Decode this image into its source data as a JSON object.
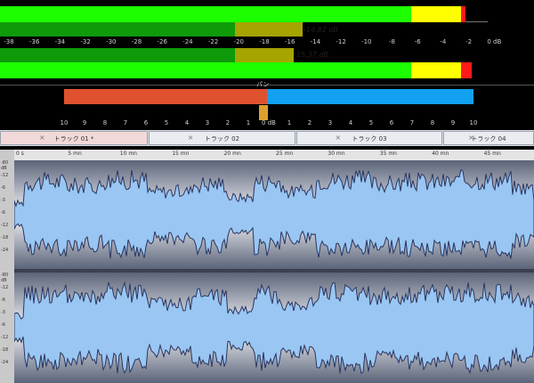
{
  "meters": {
    "scale": [
      "-38",
      "-36",
      "-34",
      "-32",
      "-30",
      "-28",
      "-26",
      "-24",
      "-22",
      "-20",
      "-18",
      "-16",
      "-14",
      "-12",
      "-10",
      "-8",
      "-6",
      "-4",
      "-2",
      "0 dB"
    ],
    "peak_top": "-14.82 dB",
    "peak_bottom": "15.37 dB"
  },
  "pan": {
    "label": "パン",
    "scale": [
      "10",
      "9",
      "8",
      "7",
      "6",
      "5",
      "4",
      "3",
      "2",
      "1",
      "0 dB",
      "1",
      "2",
      "3",
      "4",
      "5",
      "6",
      "7",
      "8",
      "9",
      "10"
    ]
  },
  "tabs": [
    {
      "label": "トラック 01 *",
      "active": true
    },
    {
      "label": "トラック 02",
      "active": false
    },
    {
      "label": "トラック 03",
      "active": false
    },
    {
      "label": "トラック 04",
      "active": false
    }
  ],
  "ruler": [
    "0 s",
    "5 mn",
    "10 mn",
    "15 mn",
    "20 mn",
    "25 mn",
    "30 mn",
    "35 mn",
    "40 mn",
    "45 mn"
  ],
  "vscale_top": [
    "-80 dB",
    "-12",
    "-6",
    "-3",
    "-6",
    "-12",
    "-18",
    "-24"
  ],
  "vscale_bottom": [
    "-80 dB",
    "-12",
    "-6",
    "-3",
    "-6",
    "-12",
    "-18",
    "-24"
  ],
  "colors": {
    "meter_green": "#1dff00",
    "meter_dark_green": "#0f9a0a",
    "meter_olive": "#a6a400",
    "meter_yellow": "#ffff00",
    "meter_red": "#ff1a1a",
    "pan_left": "#e0522f",
    "pan_right": "#12a0f0",
    "wave": "#99c6f2",
    "wave_outline": "#2a3560"
  }
}
